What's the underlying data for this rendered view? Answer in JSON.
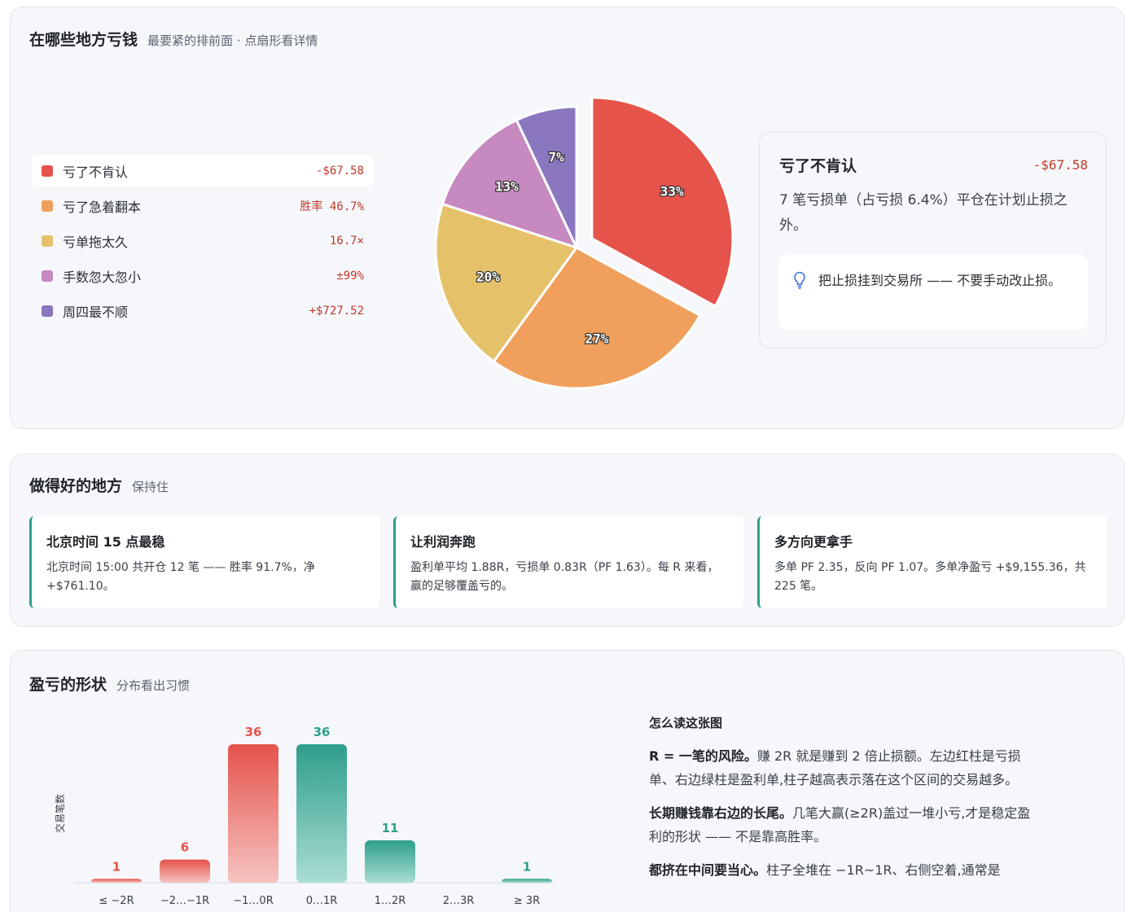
{
  "losses": {
    "title": "在哪些地方亏钱",
    "subtitle": "最要紧的排前面 · 点扇形看详情",
    "items": [
      {
        "label": "亏了不肯认",
        "value": "-$67.58",
        "color": "#e5534b",
        "pct": 33,
        "pct_label": "33%"
      },
      {
        "label": "亏了急着翻本",
        "value": "胜率 46.7%",
        "color": "#f0a05c",
        "pct": 27,
        "pct_label": "27%"
      },
      {
        "label": "亏单拖太久",
        "value": "16.7×",
        "color": "#e5c26a",
        "pct": 20,
        "pct_label": "20%"
      },
      {
        "label": "手数忽大忽小",
        "value": "±99%",
        "color": "#c689c0",
        "pct": 13,
        "pct_label": "13%"
      },
      {
        "label": "周四最不顺",
        "value": "+$727.52",
        "color": "#8b77c0",
        "pct": 7,
        "pct_label": "7%"
      }
    ],
    "detail": {
      "title": "亏了不肯认",
      "value": "-$67.58",
      "desc": "7 笔亏损单（占亏损 6.4%）平仓在计划止损之外。",
      "tip": "把止损挂到交易所 —— 不要手动改止损。",
      "tip_icon": "lightbulb-icon"
    }
  },
  "good": {
    "title": "做得好的地方",
    "subtitle": "保持住",
    "cards": [
      {
        "title": "北京时间 15 点最稳",
        "desc": "北京时间 15:00 共开仓 12 笔 —— 胜率 91.7%，净 +$761.10。"
      },
      {
        "title": "让利润奔跑",
        "desc": "盈利单平均 1.88R，亏损单 0.83R（PF 1.63）。每 R 来看，赢的足够覆盖亏的。"
      },
      {
        "title": "多方向更拿手",
        "desc": "多单 PF 2.35，反向 PF 1.07。多单净盈亏 +$9,155.36，共 225 笔。"
      }
    ]
  },
  "shape": {
    "title": "盈亏的形状",
    "subtitle": "分布看出习惯",
    "explain_title": "怎么读这张图",
    "paras": [
      {
        "b": "R = 一笔的风险。",
        "t": "赚 2R 就是赚到 2 倍止损额。左边红柱是亏损单、右边绿柱是盈利单,柱子越高表示落在这个区间的交易越多。"
      },
      {
        "b": "长期赚钱靠右边的长尾。",
        "t": "几笔大赢(≥2R)盖过一堆小亏,才是稳定盈利的形状 —— 不是靠高胜率。"
      },
      {
        "b": "都挤在中间要当心。",
        "t": "柱子全堆在 −1R~1R、右侧空着,通常是"
      }
    ]
  },
  "chart_data": {
    "type": "bar",
    "categories": [
      "≤ −2R",
      "−2…−1R",
      "−1…0R",
      "0…1R",
      "1…2R",
      "2…3R",
      "≥ 3R"
    ],
    "values": [
      1,
      6,
      36,
      36,
      11,
      0,
      1
    ],
    "side": [
      "loss",
      "loss",
      "loss",
      "win",
      "win",
      "win",
      "win"
    ],
    "ylabel": "交易笔数",
    "ylim": [
      0,
      36
    ],
    "colors": {
      "loss": "#e5534b",
      "win": "#2e9e8a"
    }
  }
}
